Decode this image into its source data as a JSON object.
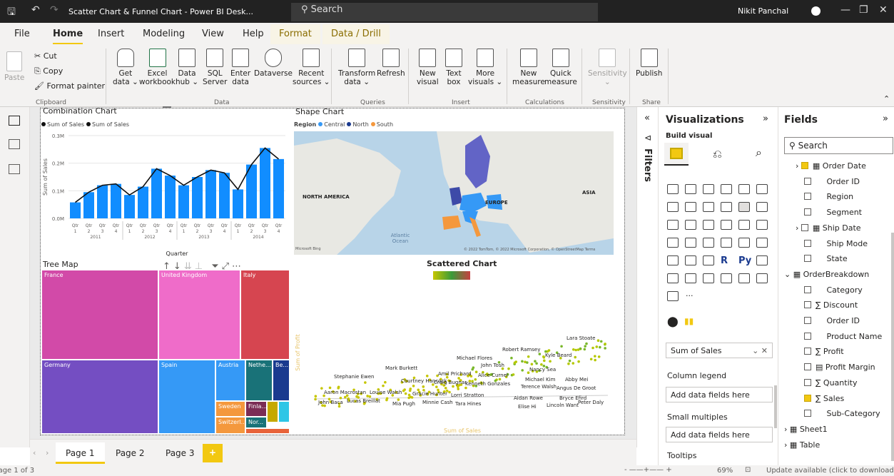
{
  "titlebar": {
    "title": "Scatter Chart & Funnel Chart - Power BI Desk...",
    "search": "Search",
    "user": "Nikit Panchal"
  },
  "tabs": [
    "File",
    "Home",
    "Insert",
    "Modeling",
    "View",
    "Help",
    "Format",
    "Data / Drill"
  ],
  "ribbon": {
    "clipboard": {
      "paste": "Paste",
      "cut": "Cut",
      "copy": "Copy",
      "format_painter": "Format painter",
      "group": "Clipboard"
    },
    "data": {
      "get_data": [
        "Get",
        "data ⌄"
      ],
      "excel": [
        "Excel",
        "workbook"
      ],
      "hub": [
        "Data",
        "hub ⌄"
      ],
      "sql": [
        "SQL",
        "Server"
      ],
      "enter": [
        "Enter",
        "data"
      ],
      "dataverse": "Dataverse",
      "recent": [
        "Recent",
        "sources ⌄"
      ],
      "group": "Data"
    },
    "queries": {
      "transform": [
        "Transform",
        "data ⌄"
      ],
      "refresh": "Refresh",
      "group": "Queries"
    },
    "insert": {
      "new_visual": [
        "New",
        "visual"
      ],
      "text_box": [
        "Text",
        "box"
      ],
      "more": [
        "More",
        "visuals ⌄"
      ],
      "group": "Insert"
    },
    "calc": {
      "new_measure": [
        "New",
        "measure"
      ],
      "quick": [
        "Quick",
        "measure"
      ],
      "group": "Calculations"
    },
    "sensitivity": {
      "label": "Sensitivity",
      "group": "Sensitivity"
    },
    "share": {
      "publish": "Publish",
      "group": "Share"
    }
  },
  "visuals": {
    "combo": {
      "title": "Combination Chart",
      "legend": [
        "Sum of Sales",
        "Sum of Sales"
      ],
      "ylabel": "Sum of Sales",
      "xlabel": "Quarter"
    },
    "shape": {
      "title": "Shape Chart",
      "legend_title": "Region",
      "legend": [
        "Central",
        "North",
        "South"
      ],
      "labels": [
        "NORTH AMERICA",
        "EUROPE",
        "ASIA",
        "Atlantic Ocean"
      ],
      "copyright": "© 2022 TomTom, © 2022 Microsoft Corporation, © OpenStreetMap  Terms",
      "bing": "Microsoft Bing"
    },
    "treemap": {
      "title": "Tree Map"
    },
    "scatter": {
      "title": "Scattered Chart",
      "ylabel": "Sum of Profit",
      "xlabel": "Sum of Sales"
    }
  },
  "chart_data": [
    {
      "type": "bar",
      "title": "Combination Chart",
      "ylabel": "Sum of Sales",
      "xlabel": "Quarter",
      "categories": [
        "Qtr 1 2011",
        "Qtr 2 2011",
        "Qtr 3 2011",
        "Qtr 4 2011",
        "Qtr 1 2012",
        "Qtr 2 2012",
        "Qtr 3 2012",
        "Qtr 4 2012",
        "Qtr 1 2013",
        "Qtr 2 2013",
        "Qtr 3 2013",
        "Qtr 4 2013",
        "Qtr 1 2014",
        "Qtr 2 2014",
        "Qtr 3 2014",
        "Qtr 4 2014"
      ],
      "ticks": {
        "quarters": [
          "Qtr",
          "Qtr",
          "Qtr",
          "Qtr",
          "Qtr",
          "Qtr",
          "Qtr",
          "Qtr",
          "Qtr",
          "Qtr",
          "Qtr",
          "Qtr",
          "Qtr",
          "Qtr",
          "Qtr",
          "Qtr"
        ],
        "nums": [
          "1",
          "2",
          "3",
          "4",
          "1",
          "2",
          "3",
          "4",
          "1",
          "2",
          "3",
          "4",
          "1",
          "2",
          "3",
          "4"
        ],
        "years": [
          "2011",
          "2012",
          "2013",
          "2014"
        ]
      },
      "yticks": [
        "0.3M",
        "0.2M",
        "0.1M",
        "0.0M"
      ],
      "ylim": [
        0,
        0.3
      ],
      "series": [
        {
          "name": "Sum of Sales",
          "kind": "bar",
          "values": [
            0.058,
            0.095,
            0.12,
            0.125,
            0.085,
            0.115,
            0.18,
            0.155,
            0.12,
            0.15,
            0.175,
            0.165,
            0.105,
            0.195,
            0.255,
            0.215
          ]
        },
        {
          "name": "Sum of Sales",
          "kind": "line",
          "values": [
            0.058,
            0.095,
            0.12,
            0.125,
            0.085,
            0.115,
            0.18,
            0.155,
            0.12,
            0.15,
            0.175,
            0.165,
            0.105,
            0.195,
            0.255,
            0.215
          ]
        }
      ]
    },
    {
      "type": "treemap",
      "title": "Tree Map",
      "items": [
        {
          "label": "France",
          "color": "#d24aa8"
        },
        {
          "label": "United Kingdom",
          "color": "#ef6cc9"
        },
        {
          "label": "Italy",
          "color": "#d64550"
        },
        {
          "label": "Germany",
          "color": "#744ec2"
        },
        {
          "label": "Spain",
          "color": "#3599f6"
        },
        {
          "label": "Austria",
          "color": "#3599f6"
        },
        {
          "label": "Nethe...",
          "color": "#197278"
        },
        {
          "label": "Be...",
          "color": "#1a3a8f"
        },
        {
          "label": "Sweden",
          "color": "#f4983d"
        },
        {
          "label": "Finla...",
          "color": "#7b2c55"
        },
        {
          "label": "Switzerl...",
          "color": "#f4983d"
        },
        {
          "label": "Nor...",
          "color": "#197278"
        }
      ]
    },
    {
      "type": "scatter",
      "title": "Scattered Chart",
      "xlabel": "Sum of Sales",
      "ylabel": "Sum of Profit",
      "labels": [
        "Lara Stoate",
        "Robert Ramsey",
        "Kyle Beard",
        "Michael Flores",
        "Nancy Sea",
        "Mark Burkett",
        "John Tosh",
        "Michael Kim",
        "Abby Mei",
        "Stephanie Ewen",
        "Amil Prichard",
        "Alice Curnel",
        "Courtney Hancock",
        "Craig Bugnar",
        "Kenneth Gonzales",
        "Terence Walsh",
        "Angus De Groot",
        "Aaron Macrostan",
        "Louise Walsh",
        "Gracie Hunter",
        "Lorri Stratton",
        "Aidan Rowe",
        "Bryce Efird",
        "John Baca",
        "Lucas Breillat",
        "Mia Pugh",
        "Minnie Cash",
        "Tara Hines",
        "Elise Hi",
        "Lincoln Want",
        "Peter Daly"
      ]
    }
  ],
  "filters": {
    "label": "Filters"
  },
  "viz": {
    "title": "Visualizations",
    "build": "Build visual",
    "r": "R",
    "py": "Py",
    "more": "···",
    "value_well": "Sum of Sales",
    "column_legend": "Column legend",
    "add1": "Add data fields here",
    "small_multiples": "Small multiples",
    "add2": "Add data fields here",
    "tooltips": "Tooltips"
  },
  "fields": {
    "title": "Fields",
    "search": "Search",
    "items": [
      {
        "label": "Order Date",
        "checked": true,
        "type": "date"
      },
      {
        "label": "Order ID"
      },
      {
        "label": "Region"
      },
      {
        "label": "Segment"
      },
      {
        "label": "Ship Date",
        "type": "date"
      },
      {
        "label": "Ship Mode"
      },
      {
        "label": "State"
      },
      {
        "label": "OrderBreakdown",
        "type": "table"
      },
      {
        "label": "Category"
      },
      {
        "label": "Discount",
        "sigma": true
      },
      {
        "label": "Order ID"
      },
      {
        "label": "Product Name"
      },
      {
        "label": "Profit",
        "sigma": true
      },
      {
        "label": "Profit Margin",
        "calc": true
      },
      {
        "label": "Quantity",
        "sigma": true
      },
      {
        "label": "Sales",
        "sigma": true,
        "checked": true
      },
      {
        "label": "Sub-Category"
      },
      {
        "label": "Sheet1",
        "type": "table"
      },
      {
        "label": "Table",
        "type": "table"
      }
    ]
  },
  "pages": [
    "Page 1",
    "Page 2",
    "Page 3",
    "+"
  ],
  "status": {
    "page": "Page 1 of 3",
    "zoom": "69%",
    "update": "Update available (click to download)"
  }
}
